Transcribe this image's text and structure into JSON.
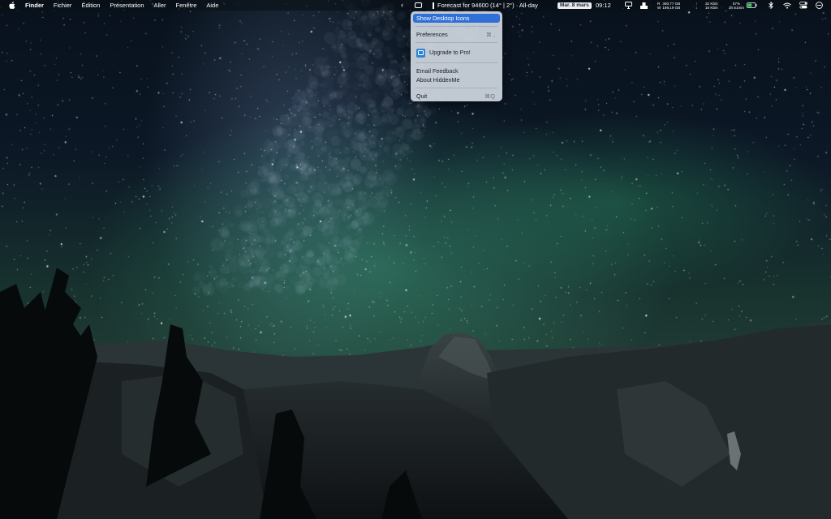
{
  "menubar": {
    "app_name": "Finder",
    "menus": [
      "Fichier",
      "Édition",
      "Présentation",
      "Aller",
      "Fenêtre",
      "Aide"
    ],
    "collapse_arrow": "‹",
    "weather_text": "Forecast for 94600 (14° | 2°) · All-day",
    "date": "Mar. 8 mars",
    "time": "09:12",
    "disk_top": "300.77 GB",
    "disk_bottom": "199.19 GB",
    "net_up": "32 Kb/s",
    "net_down": "16 Kb/s",
    "battery_pct": "57%",
    "battery_time": "2h 51min",
    "battery_level": 0.57,
    "status_icons": [
      "presentation-icon",
      "user-icon",
      "bluetooth-icon",
      "wifi-icon",
      "control-center-icon",
      "clock-icon"
    ]
  },
  "menu": {
    "items": [
      {
        "label": "Show Desktop Icons",
        "shortcut": "",
        "selected": true
      },
      {
        "label": "Preferences",
        "shortcut": "⌘ ,"
      },
      {
        "label": "Upgrade to Pro!",
        "shortcut": ""
      },
      {
        "label": "Email Feedback",
        "shortcut": ""
      },
      {
        "label": "About HiddenMe",
        "shortcut": ""
      },
      {
        "label": "Quit",
        "shortcut": "⌘Q"
      }
    ]
  },
  "colors": {
    "menu_highlight": "#2f6fd6",
    "battery_green": "#30d158"
  }
}
